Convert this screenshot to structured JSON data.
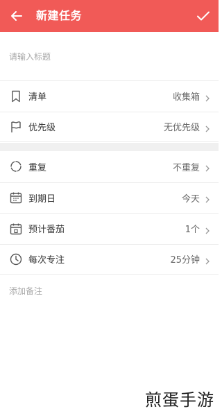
{
  "header": {
    "title": "新建任务",
    "back_icon": "arrow-left-icon",
    "confirm_icon": "check-icon",
    "bar_color": "#f15a57"
  },
  "title_field": {
    "placeholder": "请输入标题",
    "value": ""
  },
  "group1": [
    {
      "icon": "bookmark-icon",
      "label": "清单",
      "value": "收集箱"
    },
    {
      "icon": "flag-icon",
      "label": "优先级",
      "value": "无优先级"
    }
  ],
  "group2": [
    {
      "icon": "repeat-icon",
      "label": "重复",
      "value": "不重复"
    },
    {
      "icon": "calendar-icon",
      "label": "到期日",
      "value": "今天"
    },
    {
      "icon": "pomodoro-calendar-icon",
      "label": "预计番茄",
      "value": "1个"
    },
    {
      "icon": "clock-icon",
      "label": "每次专注",
      "value": "25分钟"
    }
  ],
  "note": {
    "label": "添加备注"
  },
  "watermark": {
    "text": "煎蛋手游"
  }
}
